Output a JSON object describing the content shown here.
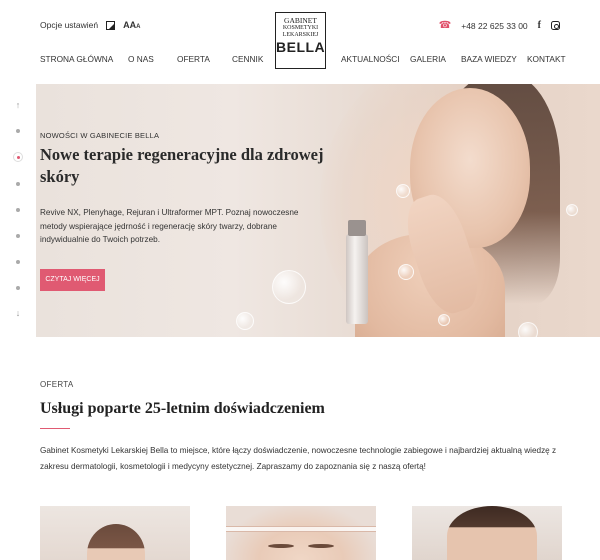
{
  "topbar": {
    "options_label": "Opcje ustawień",
    "font_size_label": "AAA",
    "phone": "+48 22 625 33 00"
  },
  "logo": {
    "line1": "GABINET",
    "line2": "KOSMETYKI",
    "line3": "LEKARSKIEJ",
    "line4": "BELLA"
  },
  "nav": {
    "items": [
      {
        "label": "STRONA GŁÓWNA"
      },
      {
        "label": "O NAS"
      },
      {
        "label": "OFERTA"
      },
      {
        "label": "CENNIK"
      },
      {
        "label": "AKTUALNOŚCI"
      },
      {
        "label": "GALERIA"
      },
      {
        "label": "BAZA WIEDZY"
      },
      {
        "label": "KONTAKT"
      }
    ]
  },
  "hero": {
    "pretitle": "NOWOŚCI W GABINECIE BELLA",
    "title": "Nowe terapie regeneracyjne dla zdrowej skóry",
    "text": "Revive NX, Plenyhage, Rejuran i Ultraformer MPT. Poznaj nowoczesne metody wspierające jędrność i regenerację skóry twarzy, dobrane indywidualnie do Twoich potrzeb.",
    "cta_label": "CZYTAJ WIĘCEJ"
  },
  "slider": {
    "up_icon": "↑",
    "down_icon": "↓",
    "slide_count": 7,
    "active_index": 2
  },
  "offer": {
    "label": "OFERTA",
    "title": "Usługi poparte 25-letnim doświadczeniem",
    "text": "Gabinet Kosmetyki Lekarskiej Bella to miejsce, które łączy doświadczenie, nowoczesne technologie zabiegowe i najbardziej aktualną wiedzę z zakresu dermatologii, kosmetologii i medycyny estetycznej. Zapraszamy do zapoznania się z naszą ofertą!"
  },
  "colors": {
    "accent": "#e05a72",
    "text": "#333333"
  }
}
